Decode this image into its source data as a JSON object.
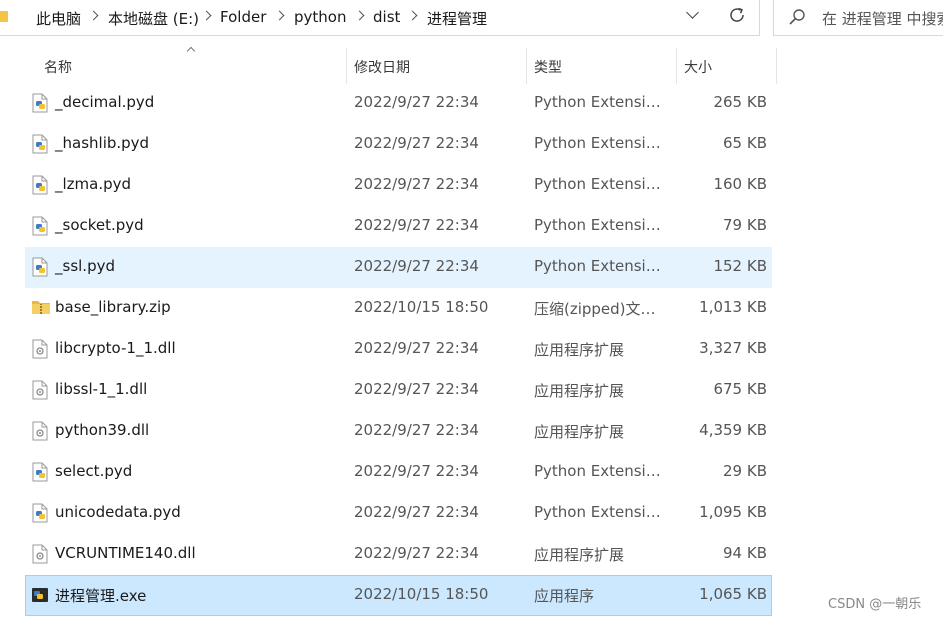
{
  "address_bar": {
    "crumbs": [
      "此电脑",
      "本地磁盘 (E:)",
      "Folder",
      "python",
      "dist",
      "进程管理"
    ]
  },
  "search": {
    "placeholder": "在 进程管理 中搜索"
  },
  "columns": {
    "name": "名称",
    "date": "修改日期",
    "type": "类型",
    "size": "大小"
  },
  "files": [
    {
      "name": "_decimal.pyd",
      "date": "2022/9/27 22:34",
      "type": "Python Extension Module",
      "size": "265 KB",
      "icon": "python-file-icon"
    },
    {
      "name": "_hashlib.pyd",
      "date": "2022/9/27 22:34",
      "type": "Python Extension Module",
      "size": "65 KB",
      "icon": "python-file-icon"
    },
    {
      "name": "_lzma.pyd",
      "date": "2022/9/27 22:34",
      "type": "Python Extension Module",
      "size": "160 KB",
      "icon": "python-file-icon"
    },
    {
      "name": "_socket.pyd",
      "date": "2022/9/27 22:34",
      "type": "Python Extension Module",
      "size": "79 KB",
      "icon": "python-file-icon"
    },
    {
      "name": "_ssl.pyd",
      "date": "2022/9/27 22:34",
      "type": "Python Extension Module",
      "size": "152 KB",
      "icon": "python-file-icon",
      "state": "hover"
    },
    {
      "name": "base_library.zip",
      "date": "2022/10/15 18:50",
      "type": "压缩(zipped)文件夹",
      "size": "1,013 KB",
      "icon": "zip-folder-icon"
    },
    {
      "name": "libcrypto-1_1.dll",
      "date": "2022/9/27 22:34",
      "type": "应用程序扩展",
      "size": "3,327 KB",
      "icon": "dll-file-icon"
    },
    {
      "name": "libssl-1_1.dll",
      "date": "2022/9/27 22:34",
      "type": "应用程序扩展",
      "size": "675 KB",
      "icon": "dll-file-icon"
    },
    {
      "name": "python39.dll",
      "date": "2022/9/27 22:34",
      "type": "应用程序扩展",
      "size": "4,359 KB",
      "icon": "dll-file-icon"
    },
    {
      "name": "select.pyd",
      "date": "2022/9/27 22:34",
      "type": "Python Extension Module",
      "size": "29 KB",
      "icon": "python-file-icon"
    },
    {
      "name": "unicodedata.pyd",
      "date": "2022/9/27 22:34",
      "type": "Python Extension Module",
      "size": "1,095 KB",
      "icon": "python-file-icon"
    },
    {
      "name": "VCRUNTIME140.dll",
      "date": "2022/9/27 22:34",
      "type": "应用程序扩展",
      "size": "94 KB",
      "icon": "dll-file-icon"
    },
    {
      "name": "进程管理.exe",
      "date": "2022/10/15 18:50",
      "type": "应用程序",
      "size": "1,065 KB",
      "icon": "exe-file-icon",
      "state": "selected"
    }
  ],
  "watermark": "CSDN @一朝乐",
  "colors": {
    "hover": "#e5f3ff",
    "selected": "#cce8ff",
    "selected_border": "#99d1ff"
  }
}
